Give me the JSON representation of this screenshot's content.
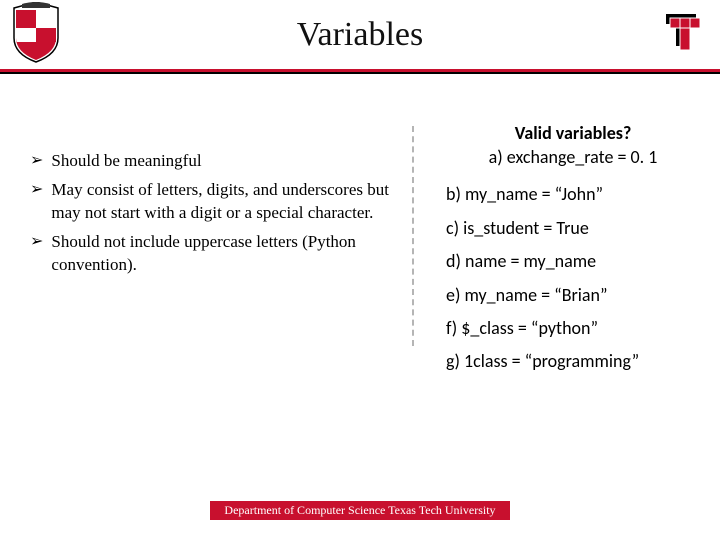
{
  "header": {
    "title": "Variables"
  },
  "bullets": [
    "Should be meaningful",
    "May consist of letters, digits, and underscores but may not start with a digit or a special character.",
    "Should not include uppercase letters (Python convention)."
  ],
  "question": {
    "title": "Valid variables?",
    "options": [
      "a) exchange_rate = 0. 1",
      "b) my_name = “John”",
      "c) is_student = True",
      "d) name = my_name",
      "e) my_name = “Brian”",
      "f) $_class = “python”",
      "g) 1class = “programming”"
    ]
  },
  "footer": {
    "text": "Department of Computer Science Texas Tech University"
  }
}
